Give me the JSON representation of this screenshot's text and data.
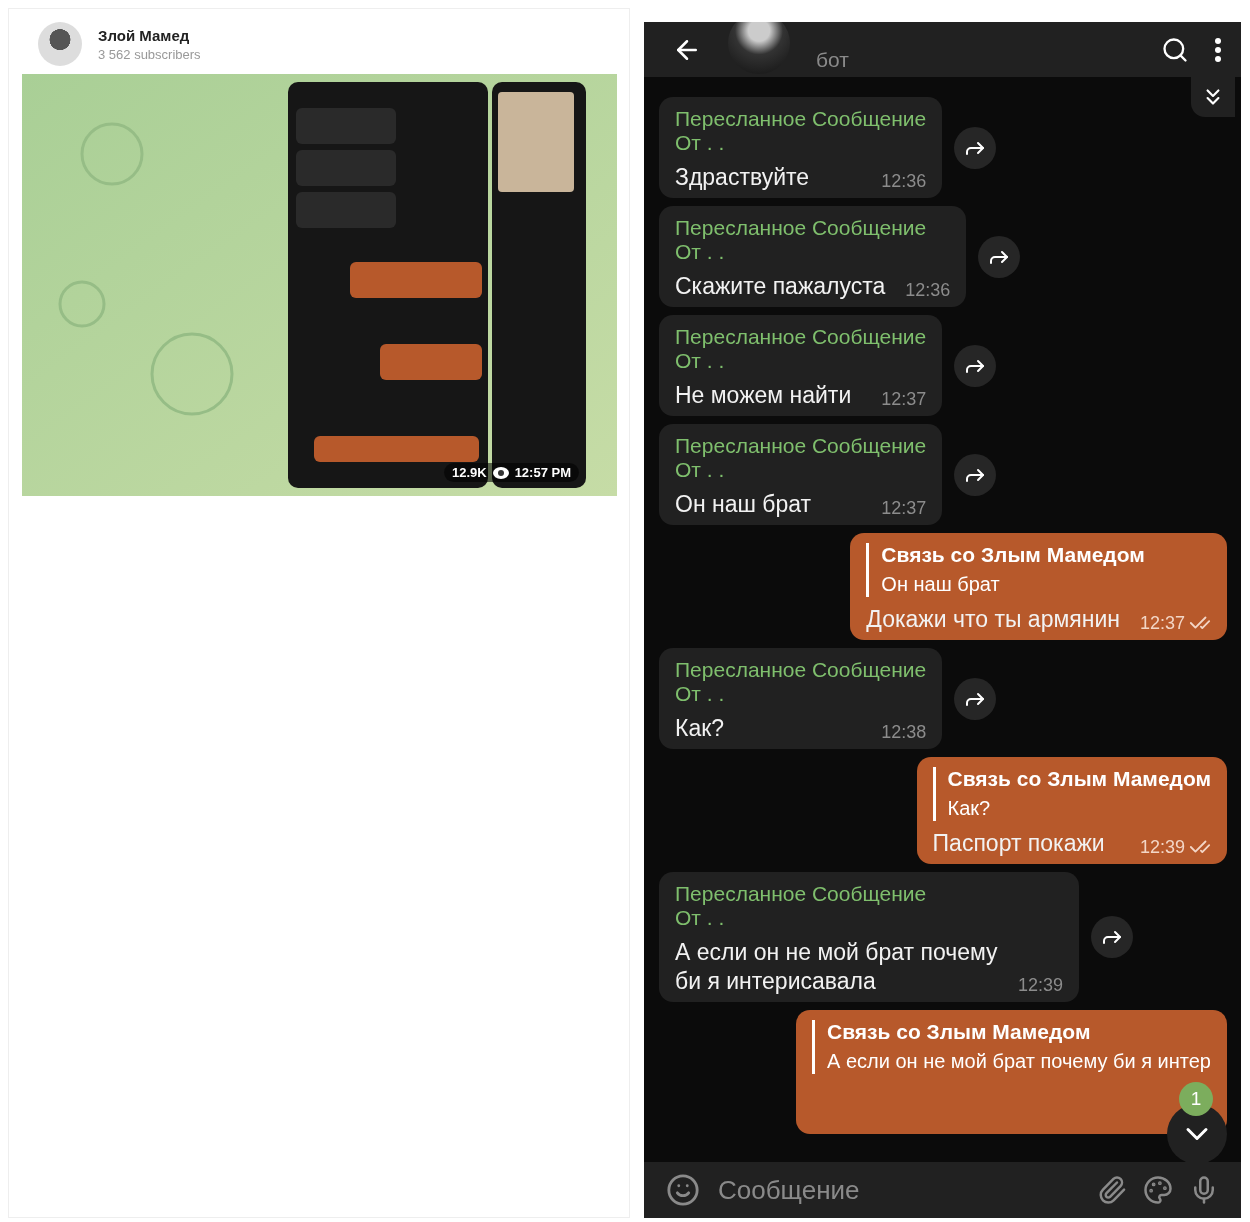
{
  "post": {
    "channel_name": "Злой Мамед",
    "subscribers": "3 562 subscribers",
    "views": "12.9K",
    "time": "12:57 PM"
  },
  "chat": {
    "subtitle": "бот",
    "messages": [
      {
        "kind": "forwarded",
        "header": "Пересланное Сообщение",
        "from": "От . .",
        "text": "Здраствуйте",
        "time": "12:36"
      },
      {
        "kind": "forwarded",
        "header": "Пересланное Сообщение",
        "from": "От . .",
        "text": "Скажите пажалуста",
        "time": "12:36"
      },
      {
        "kind": "forwarded",
        "header": "Пересланное Сообщение",
        "from": "От . .",
        "text": "Не можем найти",
        "time": "12:37"
      },
      {
        "kind": "forwarded",
        "header": "Пересланное Сообщение",
        "from": "От . .",
        "text": "Он наш брат",
        "time": "12:37"
      },
      {
        "kind": "reply",
        "reply_author": "Связь со Злым Мамедом",
        "reply_text": "Он наш брат",
        "text": "Докажи что ты армянин",
        "time": "12:37",
        "read": true
      },
      {
        "kind": "forwarded",
        "header": "Пересланное Сообщение",
        "from": "От . .",
        "text": "Как?",
        "time": "12:38"
      },
      {
        "kind": "reply",
        "reply_author": "Связь со Злым Мамедом",
        "reply_text": "Как?",
        "text": "Паспорт покажи",
        "time": "12:39",
        "read": true
      },
      {
        "kind": "forwarded",
        "header": "Пересланное Сообщение",
        "from": "От . .",
        "text": "А если он не мой брат почему би я интерисавала",
        "time": "12:39"
      },
      {
        "kind": "reply",
        "reply_author": "Связь со Злым Мамедом",
        "reply_text": "А если он не мой брат почему би я интер"
      }
    ],
    "unread_badge": "1",
    "input": {
      "placeholder": "Сообщение"
    }
  }
}
